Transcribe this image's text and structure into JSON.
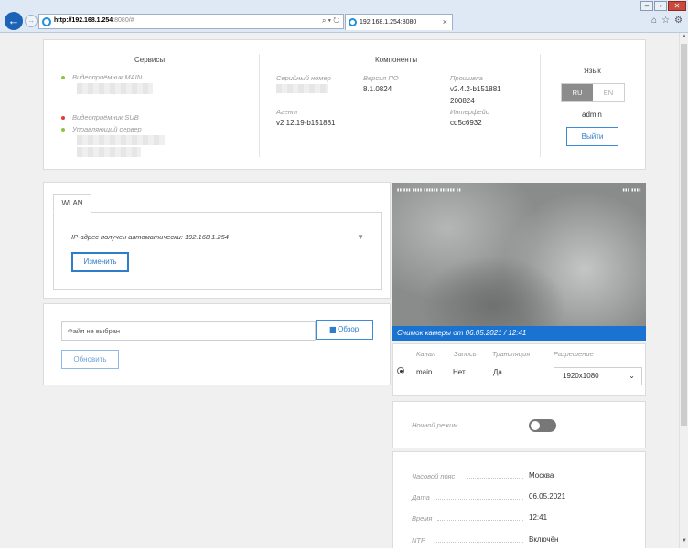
{
  "browser": {
    "url_host": "http://192.168.1.254",
    "url_rest": ":8080/#",
    "tab_title": "192.168.1.254:8080"
  },
  "services": {
    "title": "Сервисы",
    "items": [
      {
        "label": "Видеоприёмник MAIN",
        "status_color": "#8bc34a"
      },
      {
        "label": "Видеоприёмник SUB",
        "status_color": "#e53935"
      },
      {
        "label": "Управляющий сервер",
        "status_color": "#8bc34a"
      }
    ]
  },
  "components": {
    "title": "Компоненты",
    "serial_label": "Серийный номер",
    "fw_label": "Версия ПО",
    "fw_value": "8.1.0824",
    "firmware_label": "Прошивка",
    "firmware_value_1": "v2.4.2-b151881",
    "firmware_value_2": "200824",
    "agent_label": "Агент",
    "agent_value": "v2.12.19-b151881",
    "iface_label": "Интерфейс",
    "iface_value": "cd5c6932"
  },
  "language": {
    "title": "Язык",
    "options": [
      "RU",
      "EN"
    ],
    "selected": "RU",
    "user": "admin",
    "logout_label": "Выйти"
  },
  "wlan": {
    "tab_label": "WLAN",
    "ip_text": "IP-адрес получен автоматически: 192.168.1.254",
    "change_label": "Изменить"
  },
  "file": {
    "placeholder": "Файл не выбран",
    "browse_label": "Обзор",
    "update_label": "Обновить"
  },
  "camera": {
    "caption": "Снимок камеры от 06.05.2021 / 12:41",
    "accent": "#1a73d1"
  },
  "streams": {
    "headers": [
      "Канал",
      "Запись",
      "Трансляция",
      "Разрешение"
    ],
    "row": {
      "channel": "main",
      "record": "Нет",
      "broadcast": "Да",
      "resolution": "1920x1080"
    }
  },
  "night": {
    "label": "Ночной режим",
    "enabled": false
  },
  "time": {
    "timezone_label": "Часовой пояс",
    "timezone_value": "Москва",
    "date_label": "Дата",
    "date_value": "06.05.2021",
    "time_label": "Время",
    "time_value": "12:41",
    "ntp_label": "NTP",
    "ntp_value": "Включён"
  }
}
